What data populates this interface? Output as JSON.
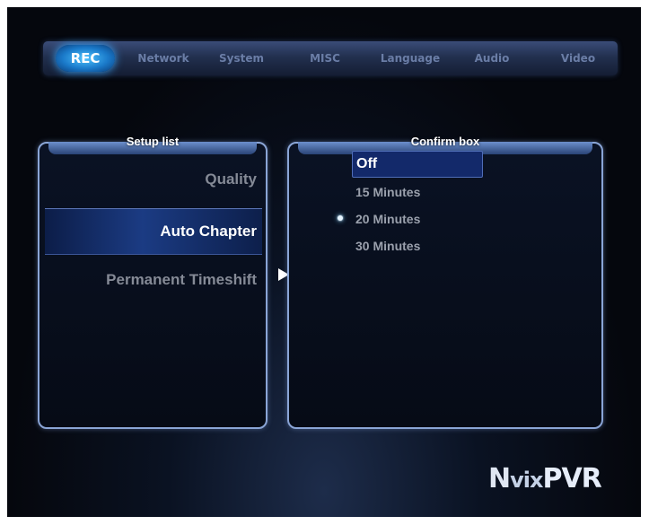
{
  "tabs": [
    {
      "label": "REC",
      "active": true
    },
    {
      "label": "Network",
      "active": false
    },
    {
      "label": "System",
      "active": false
    },
    {
      "label": "MISC",
      "active": false
    },
    {
      "label": "Language",
      "active": false
    },
    {
      "label": "Audio",
      "active": false
    },
    {
      "label": "Video",
      "active": false
    }
  ],
  "setup_list": {
    "title": "Setup list",
    "items": [
      "Quality",
      "Auto Chapter",
      "Permanent Timeshift"
    ],
    "selected": "Auto Chapter"
  },
  "confirm_box": {
    "title": "Confirm box",
    "options": [
      "Off",
      "15 Minutes",
      "20 Minutes",
      "30 Minutes"
    ],
    "highlighted": "Off",
    "current": "20 Minutes"
  },
  "logo": {
    "part1": "N",
    "part2": "vix",
    "part3": "PVR"
  },
  "colors": {
    "accent": "#1a79c9",
    "panel_border": "#8aa5d6",
    "selection": "#1b3b83"
  }
}
